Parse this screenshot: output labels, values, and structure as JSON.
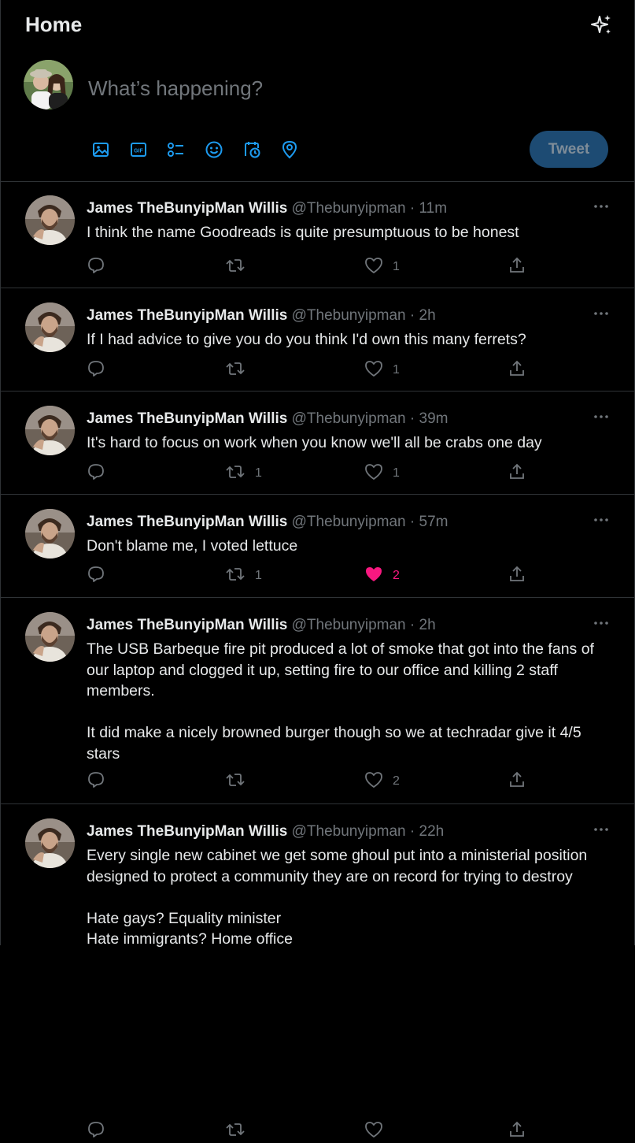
{
  "header": {
    "title": "Home",
    "icon": "sparkle-icon"
  },
  "composer": {
    "placeholder": "What’s happening?",
    "tweet_label": "Tweet",
    "tools": [
      "media-icon",
      "gif-icon",
      "poll-icon",
      "emoji-icon",
      "schedule-icon",
      "location-icon"
    ]
  },
  "tweets": [
    {
      "name": "James TheBunyipMan Willis",
      "handle": "@Thebunyipman",
      "time": "11m",
      "text": "I think the name Goodreads is quite presumptuous to be honest",
      "retweets": "",
      "likes": "1",
      "liked": false
    },
    {
      "name": "James TheBunyipMan Willis",
      "handle": "@Thebunyipman",
      "time": "2h",
      "text": "If I had advice to give you do you think I'd own this many ferrets?",
      "retweets": "",
      "likes": "1",
      "liked": false
    },
    {
      "name": "James TheBunyipMan Willis",
      "handle": "@Thebunyipman",
      "time": "39m",
      "text": "It's hard to focus on work when you know we'll all be crabs one day",
      "retweets": "1",
      "likes": "1",
      "liked": false
    },
    {
      "name": "James TheBunyipMan Willis",
      "handle": "@Thebunyipman",
      "time": "57m",
      "text": "Don't blame me, I voted lettuce",
      "retweets": "1",
      "likes": "2",
      "liked": true
    },
    {
      "name": "James TheBunyipMan Willis",
      "handle": "@Thebunyipman",
      "time": "2h",
      "text": "The USB Barbeque fire pit produced a lot of smoke that got into the fans of our laptop and clogged it up, setting fire to our office and killing 2 staff members.\n\nIt did make a nicely browned burger though so we at techradar give it 4/5 stars",
      "retweets": "",
      "likes": "2",
      "liked": false
    },
    {
      "name": "James TheBunyipMan Willis",
      "handle": "@Thebunyipman",
      "time": "22h",
      "text": "Every single new cabinet we get some ghoul put into a ministerial position designed to protect a community they are on record for trying to destroy\n\nHate gays? Equality minister\nHate immigrants? Home office",
      "retweets": "",
      "likes": "",
      "liked": false
    }
  ],
  "colors": {
    "accent": "#1d9bf0",
    "like": "#f91880",
    "muted": "#71767b",
    "divider": "#2f3336"
  }
}
